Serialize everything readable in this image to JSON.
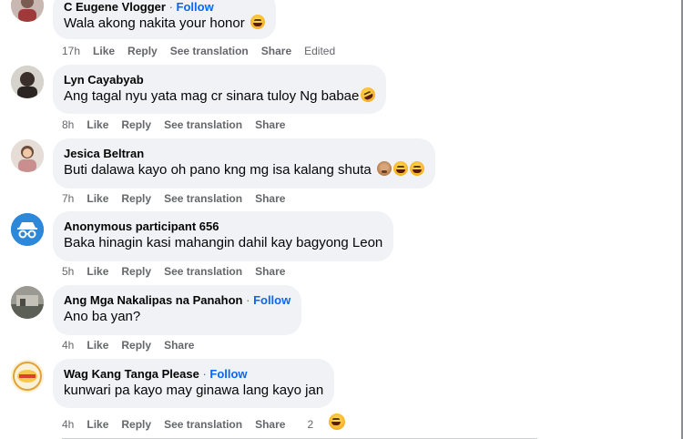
{
  "comments": [
    {
      "author": "C Eugene Vlogger",
      "follow": "Follow",
      "text": "Wala akong nakita your honor",
      "emoji": "laughing-emoji",
      "time": "17h",
      "like": "Like",
      "reply": "Reply",
      "see_translation": "See translation",
      "share": "Share",
      "edited": "Edited"
    },
    {
      "author": "Lyn Cayabyab",
      "text": "Ang tagal nyu yata mag cr sinara tuloy Ng babae",
      "emoji": "rolling-laughing-emoji",
      "time": "8h",
      "like": "Like",
      "reply": "Reply",
      "see_translation": "See translation",
      "share": "Share"
    },
    {
      "author": "Jesica Beltran",
      "text": "Buti dalawa kayo oh pano kng mg isa kalang shuta",
      "emoji": "see-no-evil-monkey-and-laughing-emoji",
      "time": "7h",
      "like": "Like",
      "reply": "Reply",
      "see_translation": "See translation",
      "share": "Share"
    },
    {
      "author": "Anonymous participant 656",
      "text": "Baka hinagin kasi mahangin dahil kay bagyong Leon",
      "time": "5h",
      "like": "Like",
      "reply": "Reply",
      "see_translation": "See translation",
      "share": "Share"
    },
    {
      "author": "Ang Mga Nakalipas na Panahon",
      "follow": "Follow",
      "text": "Ano ba yan?",
      "time": "4h",
      "like": "Like",
      "reply": "Reply",
      "share": "Share"
    },
    {
      "author": "Wag Kang Tanga Please",
      "follow": "Follow",
      "text": "kunwari pa kayo may ginawa lang kayo jan",
      "time": "4h",
      "like": "Like",
      "reply": "Reply",
      "see_translation": "See translation",
      "share": "Share",
      "reaction_count": "2",
      "reaction_icon": "laughing-emoji"
    }
  ],
  "colors": {
    "bubble": "#f0f2f5",
    "link_blue": "#0866ff",
    "meta_gray": "#65676b",
    "text": "#050505"
  }
}
